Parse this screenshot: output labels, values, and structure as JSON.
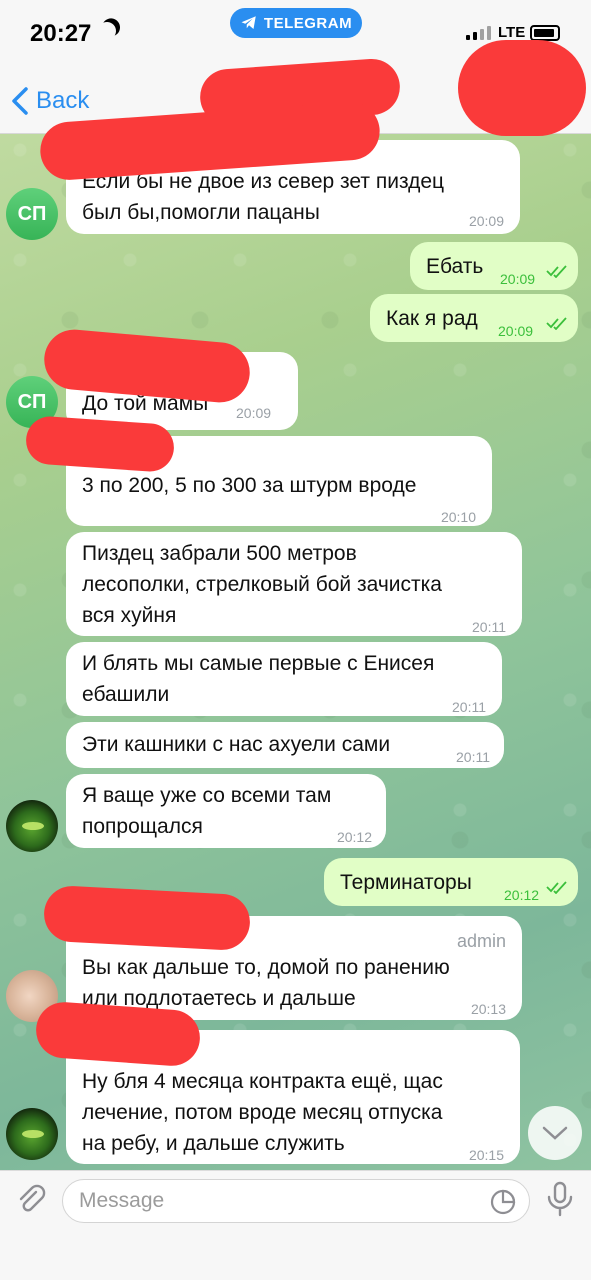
{
  "status": {
    "time": "20:27",
    "app_pill": "TELEGRAM",
    "network": "LTE"
  },
  "header": {
    "back_label": "Back"
  },
  "messages": [
    {
      "lines": [
        "Если бы не двое из север зет пиздец",
        "был бы,помогли пацаны"
      ],
      "time": "20:09",
      "avatar": "СП"
    },
    {
      "lines": [
        "Ебать"
      ],
      "time": "20:09"
    },
    {
      "lines": [
        "Как я рад"
      ],
      "time": "20:09"
    },
    {
      "lines": [
        "До той мамы"
      ],
      "time": "20:09",
      "avatar": "СП"
    },
    {
      "lines": [
        "3 по 200, 5 по 300 за штурм вроде"
      ],
      "time": "20:10"
    },
    {
      "lines": [
        "Пиздец забрали 500 метров",
        "лесополки, стрелковый бой зачистка",
        "вся хуйня"
      ],
      "time": "20:11"
    },
    {
      "lines": [
        "И блять мы самые первые с Енисея",
        "ебашили"
      ],
      "time": "20:11"
    },
    {
      "lines": [
        "Эти кашники с нас ахуели сами"
      ],
      "time": "20:11"
    },
    {
      "lines": [
        "Я ваще уже со всеми там",
        "попрощался"
      ],
      "time": "20:12"
    },
    {
      "lines": [
        "Терминаторы"
      ],
      "time": "20:12"
    },
    {
      "role": "admin",
      "lines": [
        "Вы как дальше то, домой по ранению",
        "или подлотаетесь и дальше"
      ],
      "time": "20:13"
    },
    {
      "lines": [
        "Ну бля 4 месяца контракта ещё, щас",
        "лечение, потом вроде месяц отпуска",
        "на ребу, и дальше служить"
      ],
      "time": "20:15"
    }
  ],
  "composer": {
    "placeholder": "Message"
  },
  "icons": {
    "telegram": "telegram-plane-icon",
    "back": "chevron-left-icon",
    "attach": "paperclip-icon",
    "sticker": "sticker-icon",
    "mic": "microphone-icon",
    "scroll": "chevron-down-icon",
    "read": "double-check-icon"
  },
  "colors": {
    "accent": "#2a8ef0",
    "outgoing_bubble": "#e1fec6",
    "incoming_bubble": "#ffffff",
    "read_check": "#3bbf3b",
    "redaction": "#fa3a3a"
  }
}
